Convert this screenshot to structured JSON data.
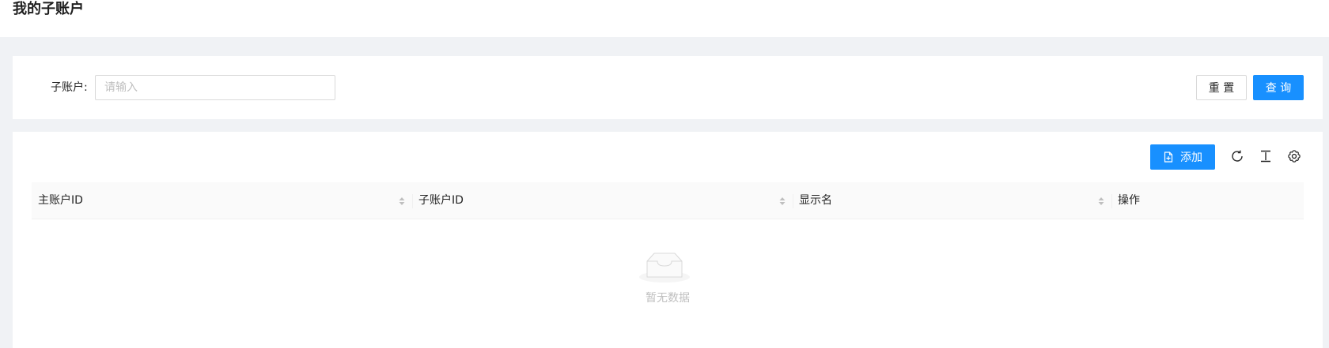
{
  "header": {
    "title": "我的子账户"
  },
  "search": {
    "label": "子账户:",
    "placeholder": "请输入",
    "value": "",
    "reset_label": "重 置",
    "query_label": "查 询"
  },
  "toolbar": {
    "add_label": "添加",
    "icons": [
      "reload-icon",
      "column-height-icon",
      "setting-icon"
    ]
  },
  "table": {
    "columns": [
      "主账户ID",
      "子账户ID",
      "显示名",
      "操作"
    ],
    "rows": [],
    "empty_text": "暂无数据"
  },
  "colors": {
    "primary": "#1890ff",
    "background": "#f0f2f5",
    "header_bg": "#fafafa"
  }
}
